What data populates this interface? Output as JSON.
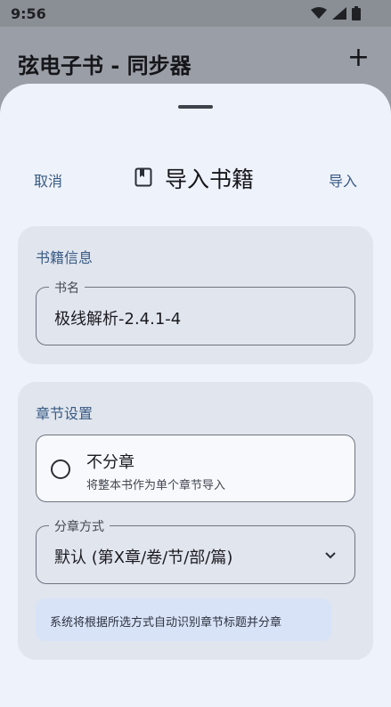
{
  "status_bar": {
    "time": "9:56",
    "icons": [
      "wifi-icon",
      "signal-icon",
      "battery-icon"
    ]
  },
  "app_bar": {
    "title": "弦电子书 - 同步器",
    "add_icon": "plus-icon"
  },
  "sheet": {
    "cancel_label": "取消",
    "title": "导入书籍",
    "title_icon": "book-icon",
    "import_label": "导入"
  },
  "book_info": {
    "section_title": "书籍信息",
    "name_label": "书名",
    "name_value": "极线解析-2.4.1-4"
  },
  "chapter_settings": {
    "section_title": "章节设置",
    "option_title": "不分章",
    "option_desc": "将整本书作为单个章节导入",
    "split_label": "分章方式",
    "split_value": "默认 (第X章/卷/节/部/篇)",
    "hint": "系统将根据所选方式自动识别章节标题并分章"
  },
  "colors": {
    "accent": "#385a83",
    "sheet_bg": "#eef2fb",
    "card_bg": "#e1e5ee",
    "hint_bg": "#d8e3f7"
  }
}
